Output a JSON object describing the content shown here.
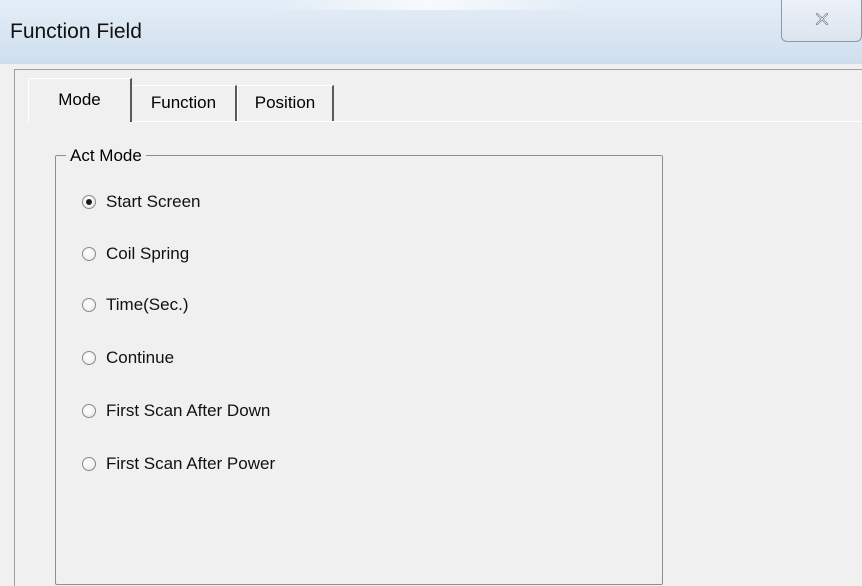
{
  "window": {
    "title": "Function Field"
  },
  "tabs": [
    {
      "label": "Mode",
      "active": true
    },
    {
      "label": "Function",
      "active": false
    },
    {
      "label": "Position",
      "active": false
    }
  ],
  "act_mode": {
    "group_label": "Act Mode",
    "options": [
      {
        "label": "Start Screen",
        "checked": true
      },
      {
        "label": "Coil Spring",
        "checked": false
      },
      {
        "label": "Time(Sec.)",
        "checked": false
      },
      {
        "label": "Continue",
        "checked": false
      },
      {
        "label": "First Scan After Down",
        "checked": false
      },
      {
        "label": "First Scan After Power",
        "checked": false
      }
    ]
  },
  "colors": {
    "titlebar": "#dbe7f3",
    "dialog_bg": "#f0f0f0",
    "text": "#000000"
  }
}
